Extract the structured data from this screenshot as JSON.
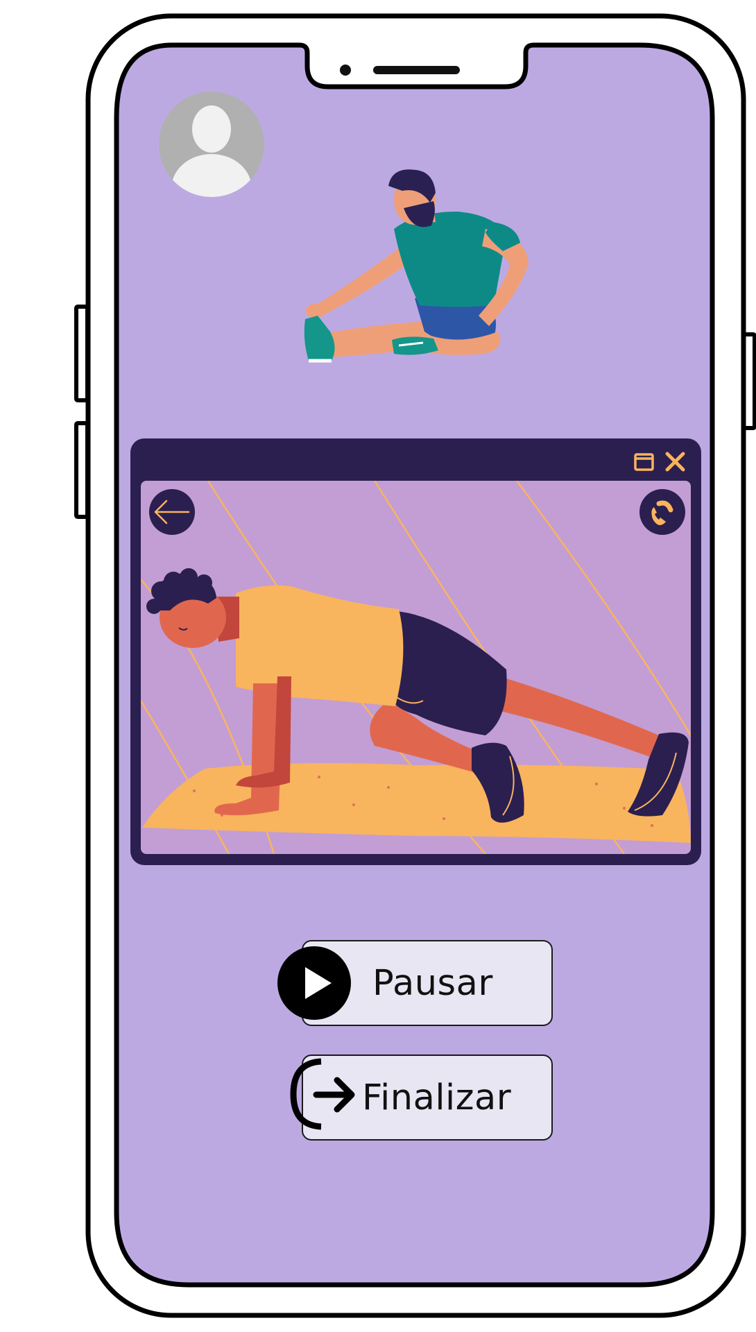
{
  "screen": {
    "background_color": "#bda9e2"
  },
  "profile": {
    "icon": "avatar-placeholder-icon"
  },
  "illustrations": {
    "top": "stretching-man-illustration",
    "video": "plank-exercise-illustration"
  },
  "video_window": {
    "icons": {
      "maximize": "window-maximize-icon",
      "close": "close-icon",
      "back": "arrow-left-icon",
      "call": "phone-icon"
    },
    "frame_color": "#2b1f4f",
    "accent_color": "#f9b45e"
  },
  "actions": {
    "pause_label": "Pausar",
    "pause_icon": "play-icon",
    "finish_label": "Finalizar",
    "finish_icon": "exit-arrow-icon"
  }
}
